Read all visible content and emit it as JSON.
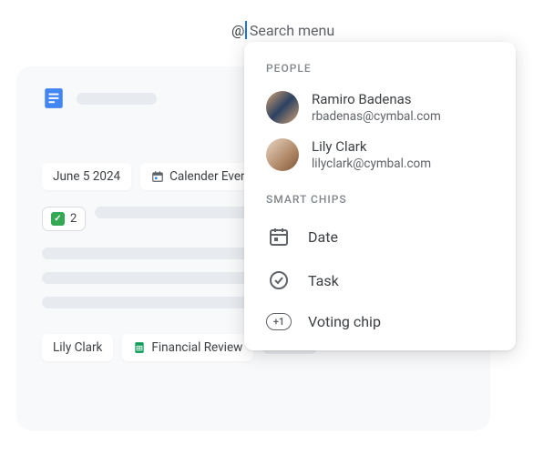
{
  "search": {
    "at": "@",
    "placeholder": "Search menu"
  },
  "doc": {
    "chips": {
      "date": "June 5 2024",
      "calendar": "Calender Event",
      "vote_count": "2",
      "person": "Lily Clark",
      "sheet": "Financial Review"
    }
  },
  "popover": {
    "people_label": "PEOPLE",
    "people": [
      {
        "name": "Ramiro Badenas",
        "email": "rbadenas@cymbal.com"
      },
      {
        "name": "Lily Clark",
        "email": "lilyclark@cymbal.com"
      }
    ],
    "chips_label": "SMART CHIPS",
    "chips": {
      "date": "Date",
      "task": "Task",
      "voting": "Voting chip",
      "vote_badge": "+1"
    }
  }
}
